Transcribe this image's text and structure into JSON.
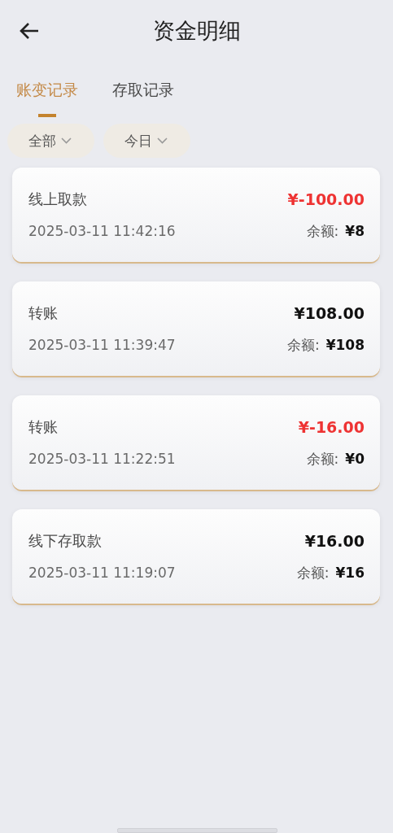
{
  "header": {
    "title": "资金明细"
  },
  "tabs": [
    {
      "label": "账变记录",
      "selected": true
    },
    {
      "label": "存取记录",
      "selected": false
    }
  ],
  "filters": [
    {
      "label": "全部"
    },
    {
      "label": "今日"
    }
  ],
  "records": [
    {
      "title": "线上取款",
      "amount": "¥-100.00",
      "kind": "out",
      "time": "2025-03-11 11:42:16",
      "balance_label": "余额:",
      "balance": "¥8"
    },
    {
      "title": "转账",
      "amount": "¥108.00",
      "kind": "in",
      "time": "2025-03-11 11:39:47",
      "balance_label": "余额:",
      "balance": "¥108"
    },
    {
      "title": "转账",
      "amount": "¥-16.00",
      "kind": "out",
      "time": "2025-03-11 11:22:51",
      "balance_label": "余额:",
      "balance": "¥0"
    },
    {
      "title": "线下存取款",
      "amount": "¥16.00",
      "kind": "in",
      "time": "2025-03-11 11:19:07",
      "balance_label": "余额:",
      "balance": "¥16"
    }
  ]
}
